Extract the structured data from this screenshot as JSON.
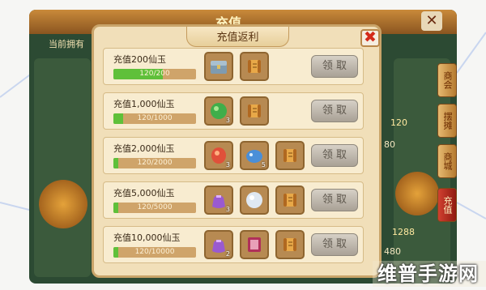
{
  "background": {
    "window_title": "充值",
    "sub_label": "当前拥有",
    "close_glyph": "✕",
    "numbers": [
      "80",
      "480"
    ],
    "badges": [
      "120",
      "1288"
    ],
    "side_tabs": [
      "商会",
      "摆摊",
      "商城",
      "充值"
    ],
    "active_tab_index": 3
  },
  "modal": {
    "title": "充值返利",
    "close_glyph": "✖",
    "claim_label": "领 取",
    "rows": [
      {
        "label": "充值200仙玉",
        "progress": "120/200",
        "fraction": 0.6,
        "items": [
          {
            "icon": "treasure-chest-icon",
            "count": ""
          },
          {
            "icon": "scroll-icon",
            "count": ""
          }
        ]
      },
      {
        "label": "充值1,000仙玉",
        "progress": "120/1000",
        "fraction": 0.12,
        "items": [
          {
            "icon": "jade-orb-icon",
            "count": "3"
          },
          {
            "icon": "scroll-icon",
            "count": ""
          }
        ]
      },
      {
        "label": "充值2,000仙玉",
        "progress": "120/2000",
        "fraction": 0.06,
        "items": [
          {
            "icon": "red-gem-icon",
            "count": "3"
          },
          {
            "icon": "blue-fish-gem-icon",
            "count": "5"
          },
          {
            "icon": "scroll-icon",
            "count": ""
          }
        ]
      },
      {
        "label": "充值5,000仙玉",
        "progress": "120/5000",
        "fraction": 0.024,
        "items": [
          {
            "icon": "purple-pouch-icon",
            "count": "3"
          },
          {
            "icon": "pearl-icon",
            "count": ""
          },
          {
            "icon": "scroll-icon",
            "count": ""
          }
        ]
      },
      {
        "label": "充值10,000仙玉",
        "progress": "120/10000",
        "fraction": 0.012,
        "items": [
          {
            "icon": "purple-pouch-icon",
            "count": "2"
          },
          {
            "icon": "book-icon",
            "count": ""
          },
          {
            "icon": "scroll-icon",
            "count": ""
          }
        ]
      }
    ]
  },
  "watermark": "维普手游网",
  "colors": {
    "progress_fill": "#5fc03a",
    "close_x": "#d42a1a",
    "modal_bg": "#f1dfb9"
  }
}
